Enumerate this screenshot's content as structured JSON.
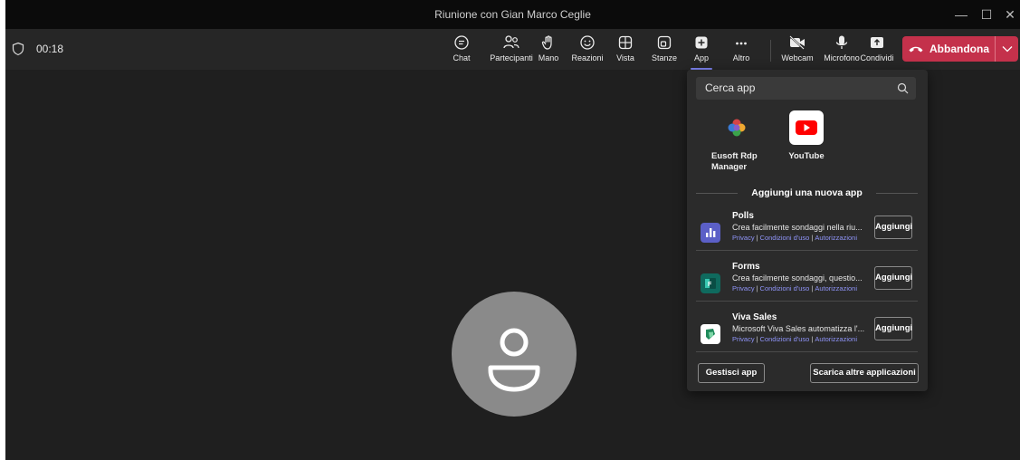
{
  "window": {
    "title": "Riunione con Gian Marco Ceglie",
    "minimize_icon": "minimize-icon",
    "maximize_icon": "maximize-icon",
    "close_icon": "close-icon"
  },
  "meeting": {
    "timer": "00:18"
  },
  "toolbar": {
    "chat": "Chat",
    "participants": "Partecipanti",
    "hand": "Mano",
    "reactions": "Reazioni",
    "view": "Vista",
    "rooms": "Stanze",
    "apps": "App",
    "more": "Altro",
    "webcam": "Webcam",
    "mic": "Microfono",
    "share": "Condividi",
    "leave": "Abbandona"
  },
  "apps_panel": {
    "search_placeholder": "Cerca app",
    "pinned": [
      {
        "name": "Eusoft Rdp Manager"
      },
      {
        "name": "YouTube"
      }
    ],
    "section_title": "Aggiungi una nuova app",
    "add_label": "Aggiungi",
    "link_privacy": "Privacy",
    "link_terms": "Condizioni d'uso",
    "link_permissions": "Autorizzazioni",
    "apps": [
      {
        "name": "Polls",
        "description": "Crea facilmente sondaggi nella riu..."
      },
      {
        "name": "Forms",
        "description": "Crea facilmente sondaggi, questio..."
      },
      {
        "name": "Viva Sales",
        "description": "Microsoft Viva Sales automatizza l'..."
      }
    ],
    "manage_label": "Gestisci app",
    "more_apps_label": "Scarica altre applicazioni"
  },
  "colors": {
    "accent": "#7f85f5",
    "leave": "#c4314b",
    "background": "#1f1f1f",
    "panel": "#2b2b2b"
  }
}
